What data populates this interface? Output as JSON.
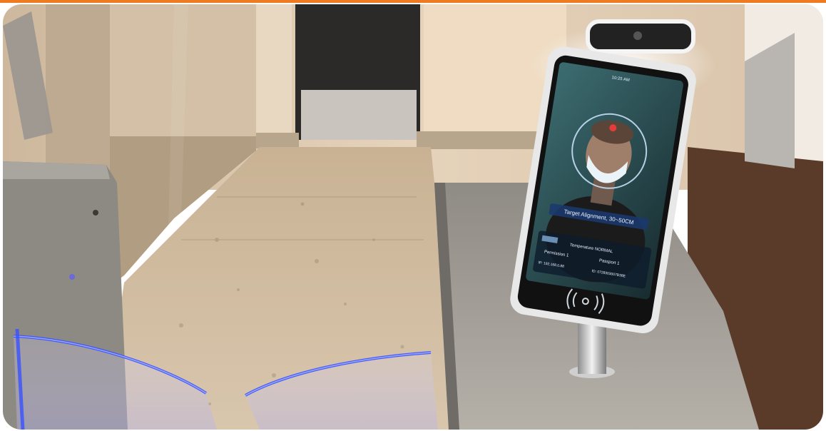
{
  "photo": {
    "accent_color": "#f07a1f",
    "scene_colors": {
      "wall": "#e3cfb6",
      "floor": "#cbb79c",
      "counter": "#a6a29c",
      "gate_light": "#3a52ff",
      "screen_bg": "#1f3b3f"
    }
  },
  "kiosk": {
    "screen": {
      "status_time": "10:25 AM",
      "alignment_prompt": "Target Alignment, 30~50CM",
      "temperature_label": "Temperature NORMAL",
      "line_one_left": "Permission 1",
      "line_one_right": "Passport 1",
      "line_two_left": "IP: 192.168.0.88",
      "line_two_right": "ID: 0728303007B38E",
      "nfc_icon": "nfc-contactless-icon"
    }
  }
}
